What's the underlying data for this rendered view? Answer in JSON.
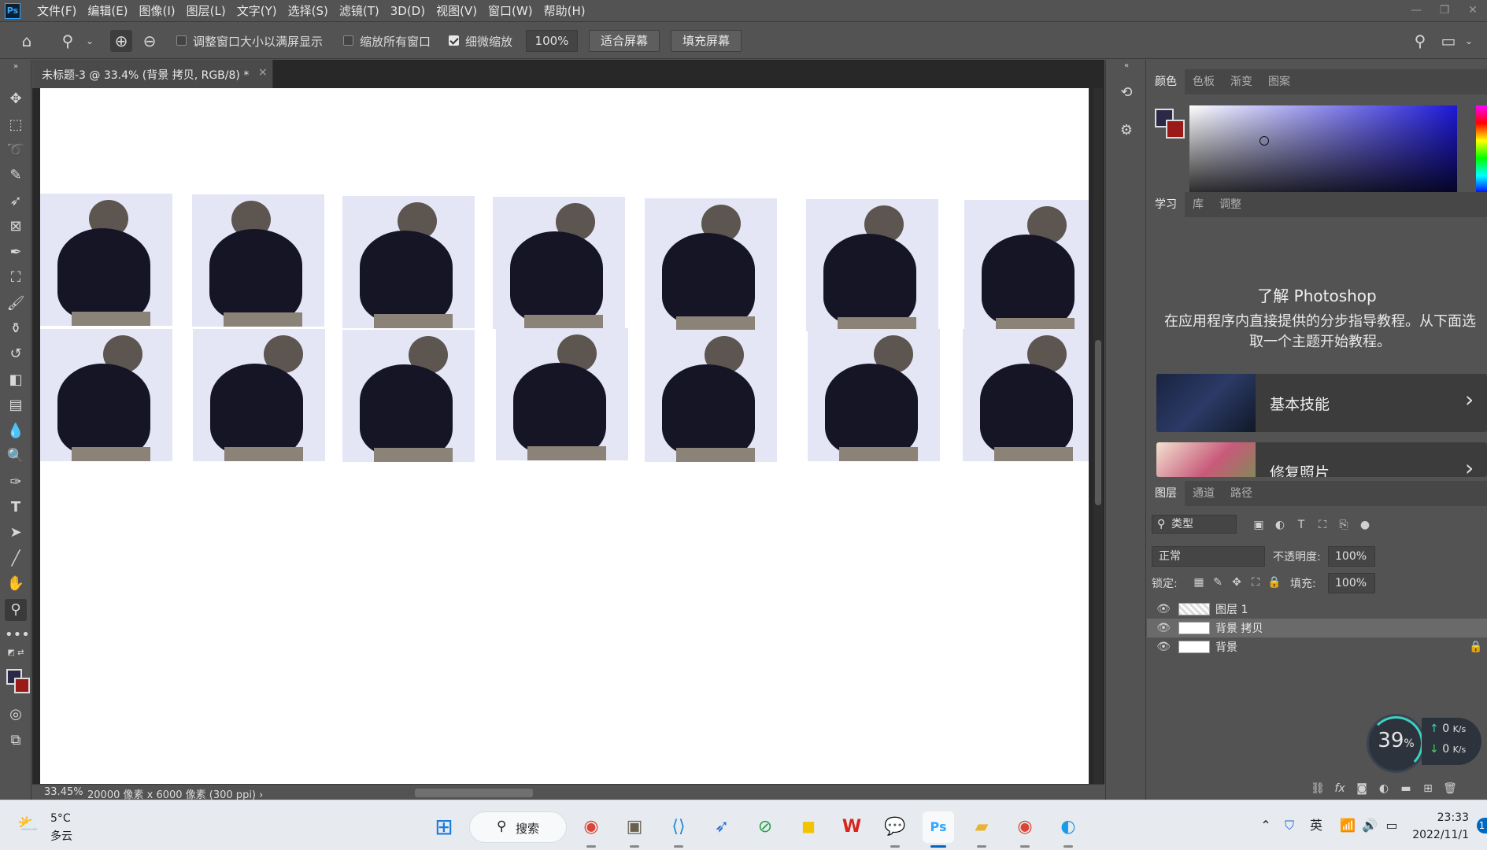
{
  "app": {
    "logo": "Ps"
  },
  "menu": [
    "文件(F)",
    "编辑(E)",
    "图像(I)",
    "图层(L)",
    "文字(Y)",
    "选择(S)",
    "滤镜(T)",
    "3D(D)",
    "视图(V)",
    "窗口(W)",
    "帮助(H)"
  ],
  "options": {
    "resize_windows_label": "调整窗口大小以满屏显示",
    "zoom_all_windows_label": "缩放所有窗口",
    "scrubby_zoom_label": "细微缩放",
    "zoom_value": "100%",
    "fit_screen_label": "适合屏幕",
    "fill_screen_label": "填充屏幕",
    "resize_windows_checked": false,
    "zoom_all_windows_checked": false,
    "scrubby_zoom_checked": true
  },
  "document": {
    "tab_title": "未标题-3 @ 33.4% (背景 拷贝, RGB/8) *",
    "close_glyph": "×",
    "zoom": "33.45%",
    "info": "20000 像素 x 6000 像素 (300 ppi)",
    "info_arrow": "›"
  },
  "panels": {
    "color_tabs": [
      "颜色",
      "色板",
      "渐变",
      "图案"
    ],
    "learn_tabs": [
      "学习",
      "库",
      "调整"
    ],
    "learn_title": "了解 Photoshop",
    "learn_description": "在应用程序内直接提供的分步指导教程。从下面选取一个主题开始教程。",
    "learn_cards": [
      "基本技能",
      "修复照片"
    ],
    "learn_arrow": "›",
    "layers_tabs": [
      "图层",
      "通道",
      "路径"
    ],
    "layer_filter": "类型",
    "blend_mode": "正常",
    "opacity_label": "不透明度:",
    "opacity_value": "100%",
    "lock_label": "锁定:",
    "fill_label": "填充:",
    "fill_value": "100%",
    "layers": [
      {
        "name": "图层 1",
        "selected": false,
        "locked": false
      },
      {
        "name": "背景 拷贝",
        "selected": true,
        "locked": false
      },
      {
        "name": "背景",
        "selected": false,
        "locked": true
      }
    ],
    "bottom_bar_fx": "fx"
  },
  "perf": {
    "value": "39",
    "unit": "%",
    "up": "0",
    "down": "0",
    "rate_unit": "K/s"
  },
  "colors": {
    "foreground": "#2a2a48",
    "background": "#9a1a1a",
    "accent": "#31a8ff"
  },
  "taskbar": {
    "weather_temp": "5°C",
    "weather_desc": "多云",
    "search_label": "搜索",
    "ime": "英",
    "time": "23:33",
    "date": "2022/11/1",
    "badge": "1",
    "apps": [
      "start-icon",
      "chrome-icon",
      "sublime-icon",
      "vscode-icon",
      "feishu-icon",
      "green-app-icon",
      "sticky-notes-icon",
      "wps-icon",
      "wechat-icon",
      "photoshop-icon",
      "file-explorer-icon",
      "chrome-profile-icon",
      "qq-icon"
    ]
  }
}
